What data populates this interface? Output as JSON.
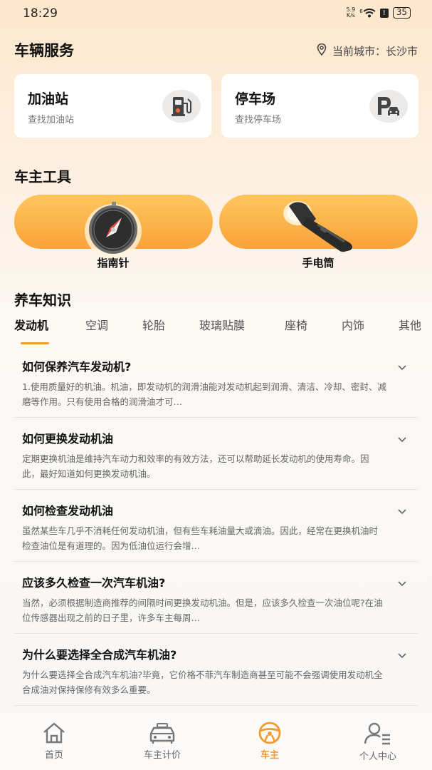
{
  "status_bar": {
    "time": "18:29",
    "net_speed_value": "5.9",
    "net_speed_unit": "K/s",
    "signal_label": "6",
    "battery": "35"
  },
  "header": {
    "title": "车辆服务",
    "city_label": "当前城市：",
    "city": "长沙市"
  },
  "services": [
    {
      "title": "加油站",
      "subtitle": "查找加油站",
      "icon": "gas-station-icon"
    },
    {
      "title": "停车场",
      "subtitle": "查找停车场",
      "icon": "parking-icon"
    }
  ],
  "tools_title": "车主工具",
  "tools": [
    {
      "label": "指南针",
      "icon": "compass-icon"
    },
    {
      "label": "手电筒",
      "icon": "flashlight-icon"
    }
  ],
  "knowledge_title": "养车知识",
  "tabs": [
    "发动机",
    "空调",
    "轮胎",
    "玻璃贴膜",
    "座椅",
    "内饰",
    "其他"
  ],
  "active_tab": "发动机",
  "articles": [
    {
      "question": "如何保养汽车发动机?",
      "answer": "1.使用质量好的机油。机油，即发动机的润滑油能对发动机起到润滑、清洁、冷却、密封、减磨等作用。只有使用合格的润滑油才可…"
    },
    {
      "question": "如何更换发动机油",
      "answer": "定期更换机油是维持汽车动力和效率的有效方法，还可以帮助延长发动机的使用寿命。因此，最好知道如何更换发动机油。"
    },
    {
      "question": "如何检查发动机油",
      "answer": "虽然某些车几乎不消耗任何发动机油，但有些车耗油量大或滴油。因此，经常在更换机油时检查油位是有道理的。因为低油位运行会增…"
    },
    {
      "question": "应该多久检查一次汽车机油?",
      "answer": "当然，必须根据制造商推荐的间隔时间更换发动机油。但是，应该多久检查一次油位呢?在油位传感器出现之前的日子里，许多车主每周…"
    },
    {
      "question": "为什么要选择全合成汽车机油?",
      "answer": "为什么要选择全合成汽车机油?毕竟，它价格不菲汽车制造商甚至可能不会强调使用发动机全合成油对保持保修有效多么重要。"
    }
  ],
  "bottom_nav": [
    {
      "label": "首页",
      "icon": "home-icon"
    },
    {
      "label": "车主计价",
      "icon": "car-icon"
    },
    {
      "label": "车主",
      "icon": "steering-wheel-icon"
    },
    {
      "label": "个人中心",
      "icon": "person-list-icon"
    }
  ],
  "accent_color": "#f39b2c"
}
